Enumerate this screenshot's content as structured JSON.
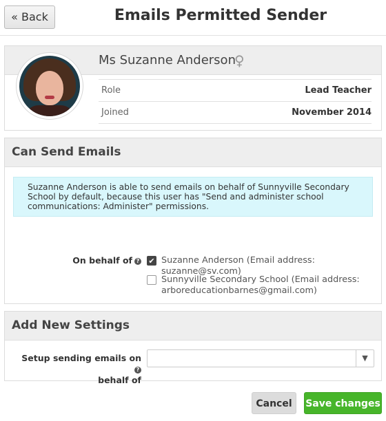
{
  "header": {
    "back_label": "« Back",
    "title": "Emails Permitted Sender"
  },
  "profile": {
    "name": "Ms Suzanne Anderson",
    "gender_symbol": "♀",
    "rows": [
      {
        "label": "Role",
        "value": "Lead Teacher"
      },
      {
        "label": "Joined",
        "value": "November 2014"
      }
    ]
  },
  "can_send": {
    "heading": "Can Send Emails",
    "notice": "Suzanne Anderson is able to send emails on behalf of Sunnyville Secondary School by default, because this user has \"Send and administer school communications: Administer\" permissions.",
    "on_behalf_label": "On behalf of",
    "options": [
      {
        "label": "Suzanne Anderson (Email address: suzanne@sv.com)",
        "checked": true
      },
      {
        "label_line1": "Sunnyville Secondary School (Email address:",
        "label_line2": "arboreducationbarnes@gmail.com)",
        "checked": false
      }
    ]
  },
  "add_new": {
    "heading": "Add New Settings",
    "setup_label_line1": "Setup sending emails on",
    "setup_label_line2": "behalf of",
    "select_value": ""
  },
  "footer": {
    "cancel_label": "Cancel",
    "save_label": "Save changes"
  },
  "icons": {
    "help": "?",
    "check": "✔",
    "dropdown": "▼"
  },
  "colors": {
    "notice_bg": "#d9f7fc",
    "save_bg": "#47b52a",
    "panel_head_bg": "#eeeeee"
  }
}
